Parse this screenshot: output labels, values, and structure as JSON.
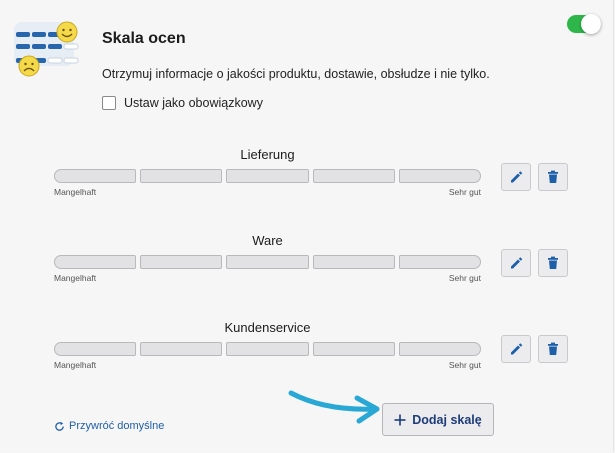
{
  "header": {
    "title": "Skala ocen",
    "description": "Otrzymuj informacje o jakości produktu, dostawie, obsłudze i nie tylko.",
    "required_checkbox_label": "Ustaw jako obowiązkowy",
    "toggle_enabled": true
  },
  "scales": [
    {
      "name": "Lieferung",
      "low_label": "Mangelhaft",
      "high_label": "Sehr gut"
    },
    {
      "name": "Ware",
      "low_label": "Mangelhaft",
      "high_label": "Sehr gut"
    },
    {
      "name": "Kundenservice",
      "low_label": "Mangelhaft",
      "high_label": "Sehr gut"
    }
  ],
  "footer": {
    "restore_label": "Przywróć domyślne",
    "add_label": "Dodaj skalę"
  },
  "colors": {
    "accent": "#1d5fa8",
    "toggle_on": "#2fb64a",
    "arrow": "#29a8d6"
  },
  "icons": {
    "edit": "pencil-icon",
    "delete": "trash-icon",
    "restore": "refresh-icon",
    "add": "plus-icon"
  }
}
